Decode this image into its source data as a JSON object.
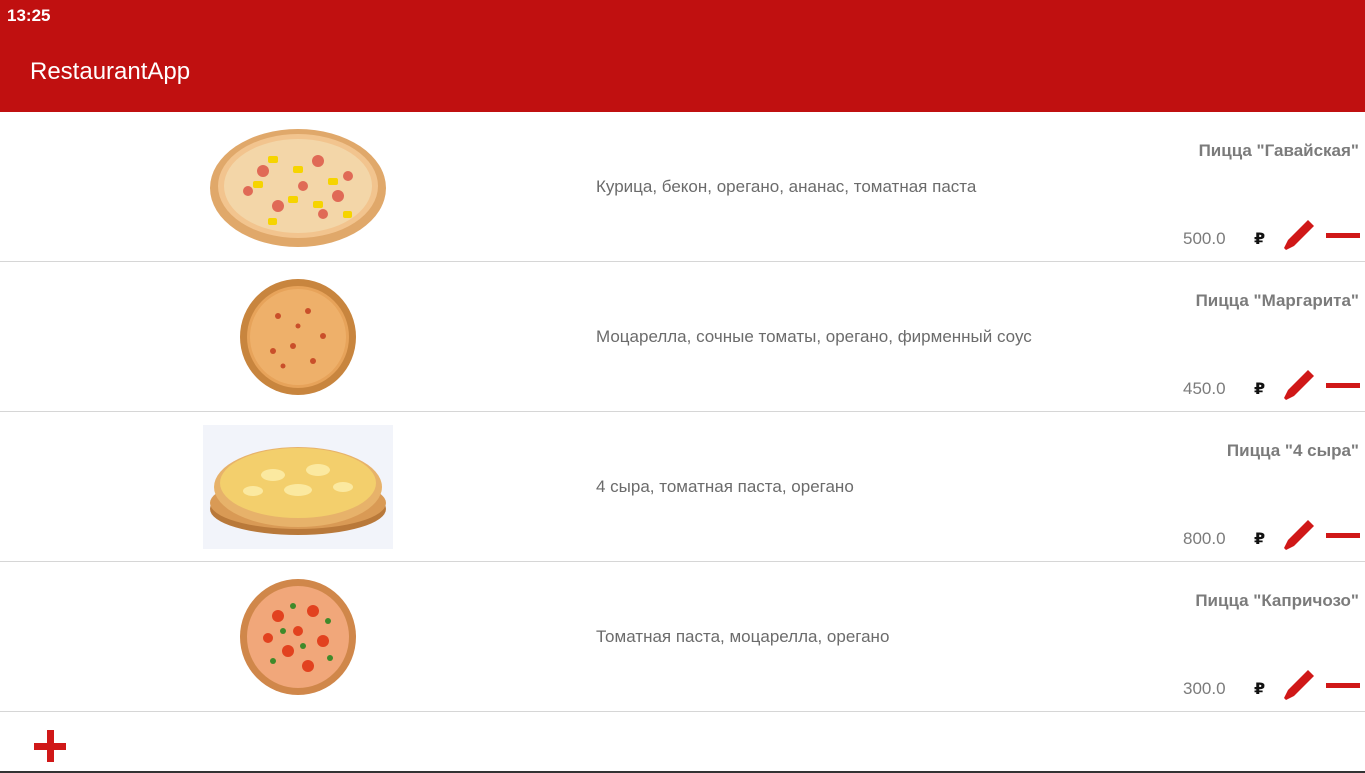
{
  "status": {
    "time": "13:25"
  },
  "appbar": {
    "title": "RestaurantApp",
    "color": "#c01010"
  },
  "accent": "#d01818",
  "menu": [
    {
      "name": "Пицца \"Гавайская\"",
      "description": "Курица, бекон, орегано, ананас, томатная паста",
      "price": "500.0",
      "currency": "₽"
    },
    {
      "name": "Пицца \"Маргарита\"",
      "description": "Моцарелла, сочные томаты, орегано, фирменный соус",
      "price": "450.0",
      "currency": "₽"
    },
    {
      "name": "Пицца \"4 сыра\"",
      "description": "4 сыра, томатная паста, орегано",
      "price": "800.0",
      "currency": "₽"
    },
    {
      "name": "Пицца \"Капричозо\"",
      "description": "Томатная паста, моцарелла, орегано",
      "price": "300.0",
      "currency": "₽"
    }
  ],
  "icons": {
    "edit": "pencil-icon",
    "remove": "minus-icon",
    "add": "plus-icon"
  }
}
